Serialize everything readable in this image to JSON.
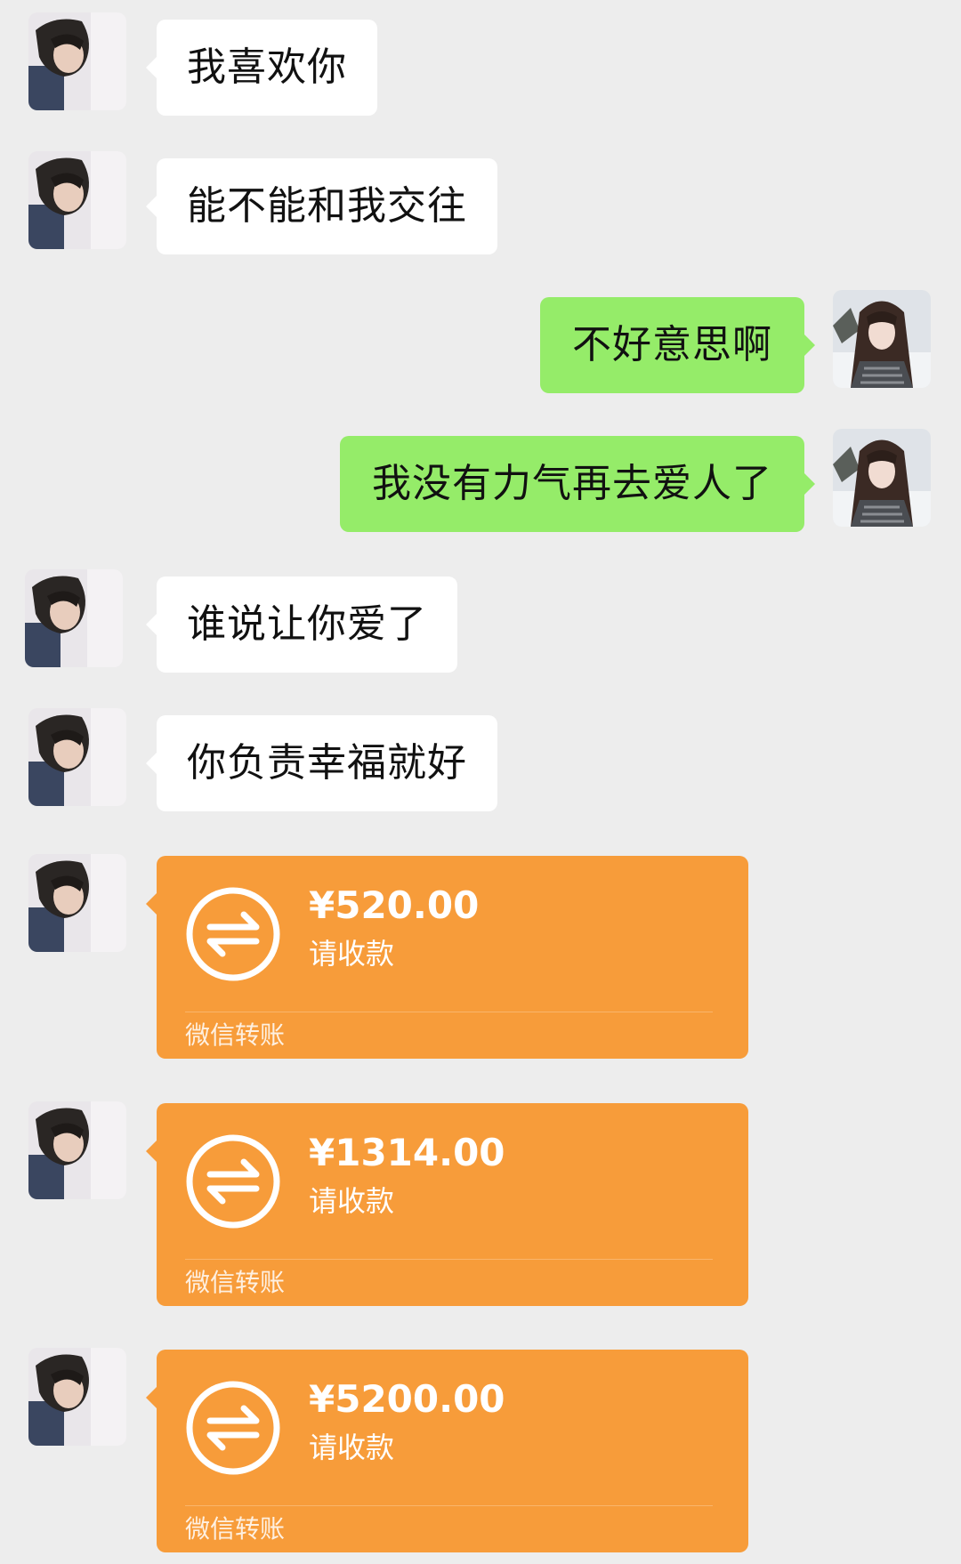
{
  "conversation": {
    "messages": [
      {
        "side": "in",
        "type": "text",
        "text": "我喜欢你"
      },
      {
        "side": "in",
        "type": "text",
        "text": "能不能和我交往"
      },
      {
        "side": "out",
        "type": "text",
        "text": "不好意思啊"
      },
      {
        "side": "out",
        "type": "text",
        "text": "我没有力气再去爱人了"
      },
      {
        "side": "in",
        "type": "text",
        "text": "谁说让你爱了"
      },
      {
        "side": "in",
        "type": "text",
        "text": "你负责幸福就好"
      },
      {
        "side": "in",
        "type": "transfer",
        "amount": "¥520.00",
        "status": "请收款",
        "footer": "微信转账"
      },
      {
        "side": "in",
        "type": "transfer",
        "amount": "¥1314.00",
        "status": "请收款",
        "footer": "微信转账"
      },
      {
        "side": "in",
        "type": "transfer",
        "amount": "¥5200.00",
        "status": "请收款",
        "footer": "微信转账"
      }
    ]
  },
  "colors": {
    "background": "#ededed",
    "incoming_bubble": "#ffffff",
    "outgoing_bubble": "#95ec69",
    "transfer_card": "#f79c3a"
  },
  "icons": {
    "contact_avatar": "boy-avatar-icon",
    "self_avatar": "girl-avatar-icon",
    "transfer": "transfer-arrows-icon"
  }
}
